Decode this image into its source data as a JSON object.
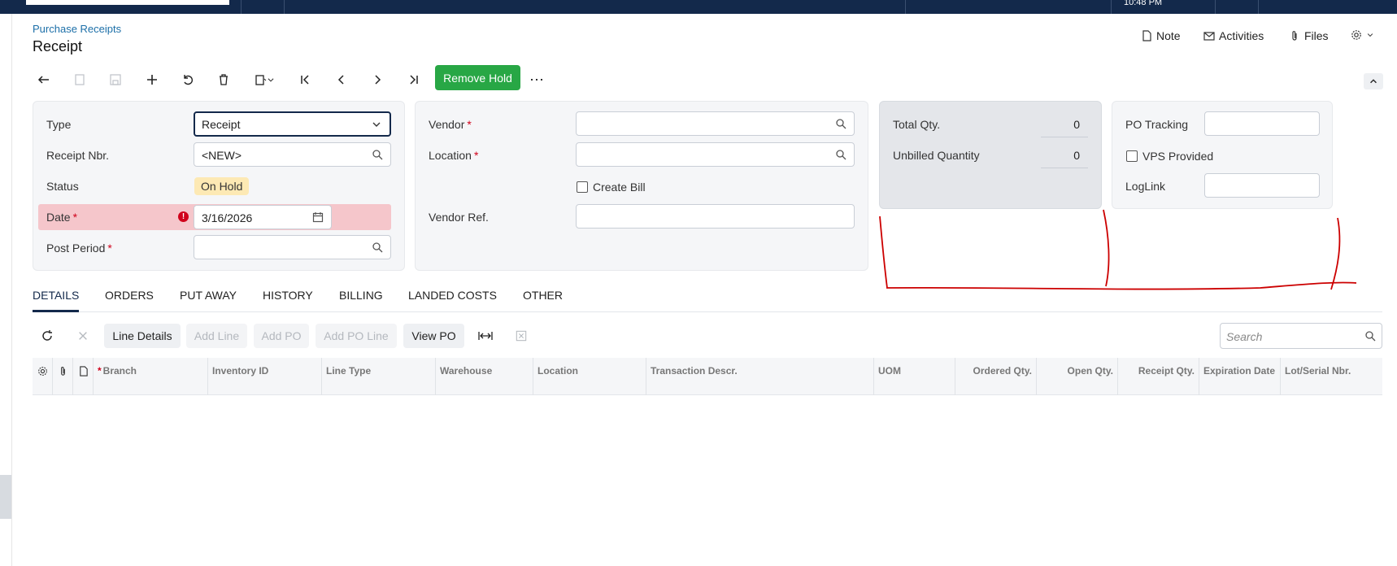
{
  "header": {
    "breadcrumb": "Purchase Receipts",
    "title": "Receipt",
    "topbar_time": "10:48 PM",
    "note": "Note",
    "activities": "Activities",
    "files": "Files"
  },
  "toolbar": {
    "remove_hold": "Remove Hold",
    "more": "⋯"
  },
  "summary": {
    "type_label": "Type",
    "type_value": "Receipt",
    "receipt_nbr_label": "Receipt Nbr.",
    "receipt_nbr_value": "<NEW>",
    "status_label": "Status",
    "status_value": "On Hold",
    "date_label": "Date",
    "date_value": "3/16/2026",
    "post_period_label": "Post Period",
    "post_period_value": "",
    "required_mark": "*"
  },
  "vendor": {
    "vendor_label": "Vendor",
    "vendor_value": "",
    "location_label": "Location",
    "location_value": "",
    "create_bill_label": "Create Bill",
    "vendor_ref_label": "Vendor Ref.",
    "vendor_ref_value": ""
  },
  "totals": {
    "total_qty_label": "Total Qty.",
    "total_qty_value": "0",
    "unbilled_qty_label": "Unbilled Quantity",
    "unbilled_qty_value": "0"
  },
  "tracking": {
    "po_tracking_label": "PO Tracking",
    "vps_provided_label": "VPS Provided",
    "loglink_label": "LogLink"
  },
  "tabs": [
    "DETAILS",
    "ORDERS",
    "PUT AWAY",
    "HISTORY",
    "BILLING",
    "LANDED COSTS",
    "OTHER"
  ],
  "grid_toolbar": {
    "line_details": "Line Details",
    "add_line": "Add Line",
    "add_po": "Add PO",
    "add_po_line": "Add PO Line",
    "view_po": "View PO",
    "search_placeholder": "Search"
  },
  "grid_columns": [
    "Branch",
    "Inventory ID",
    "Line Type",
    "Warehouse",
    "Location",
    "Transaction Descr.",
    "UOM",
    "Ordered Qty.",
    "Open Qty.",
    "Receipt Qty.",
    "Expiration Date",
    "Lot/Serial Nbr."
  ],
  "colors": {
    "nav": "#13294b",
    "accent_green": "#28a745",
    "error_bg": "#f5c6cb",
    "status_badge": "#fde9b4",
    "annotation_red": "#cc0000"
  }
}
